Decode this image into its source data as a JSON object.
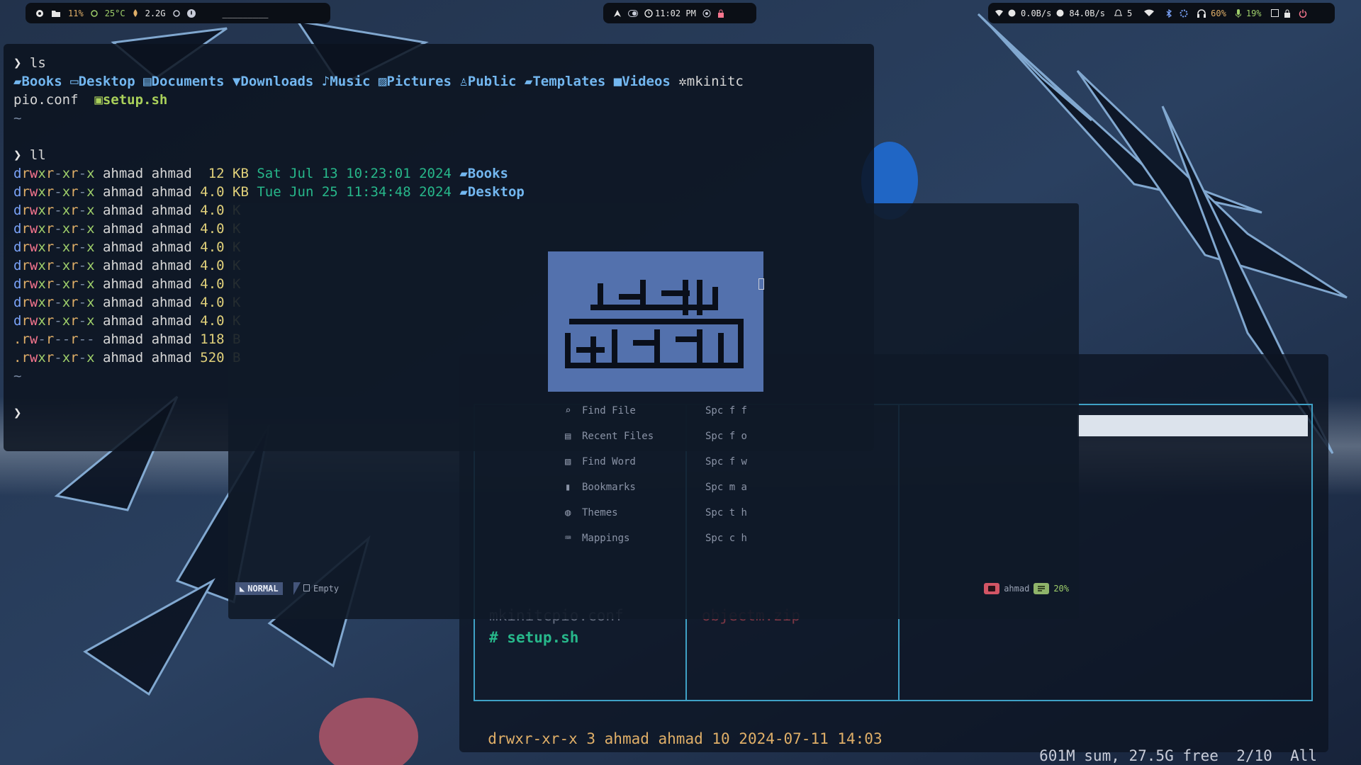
{
  "topbar": {
    "left": {
      "cpu": "11%",
      "temp": "25°C",
      "mem": "2.2G",
      "workspace_line": "_________"
    },
    "center": {
      "clock": "11:02 PM"
    },
    "right": {
      "down": "0.0B/s",
      "up": "84.0B/s",
      "notifications": "5",
      "volume": "60%",
      "mic": "19%"
    }
  },
  "terminal": {
    "prompt": "❯",
    "tilde": "~",
    "cmd1": "ls",
    "ls_items": [
      "Books",
      "Desktop",
      "Documents",
      "Downloads",
      "Music",
      "Pictures",
      "Public",
      "Templates",
      "Videos",
      "mkinitc"
    ],
    "ls_wrap": "pio.conf",
    "ls_exec": "setup.sh",
    "cmd2": "ll",
    "ll_rows": [
      {
        "type": "d",
        "perm": "rwxr-xr-x",
        "user": "ahmad",
        "group": "ahmad",
        "size": " 12 KB",
        "date": "Sat Jul 13 10:23:01 2024",
        "name": "Books"
      },
      {
        "type": "d",
        "perm": "rwxr-xr-x",
        "user": "ahmad",
        "group": "ahmad",
        "size": "4.0 KB",
        "date": "Tue Jun 25 11:34:48 2024",
        "name": "Desktop"
      },
      {
        "type": "d",
        "perm": "rwxr-xr-x",
        "user": "ahmad",
        "group": "ahmad",
        "size": "4.0 K"
      },
      {
        "type": "d",
        "perm": "rwxr-xr-x",
        "user": "ahmad",
        "group": "ahmad",
        "size": "4.0 K"
      },
      {
        "type": "d",
        "perm": "rwxr-xr-x",
        "user": "ahmad",
        "group": "ahmad",
        "size": "4.0 K"
      },
      {
        "type": "d",
        "perm": "rwxr-xr-x",
        "user": "ahmad",
        "group": "ahmad",
        "size": "4.0 K"
      },
      {
        "type": "d",
        "perm": "rwxr-xr-x",
        "user": "ahmad",
        "group": "ahmad",
        "size": "4.0 K"
      },
      {
        "type": "d",
        "perm": "rwxr-xr-x",
        "user": "ahmad",
        "group": "ahmad",
        "size": "4.0 K"
      },
      {
        "type": "d",
        "perm": "rwxr-xr-x",
        "user": "ahmad",
        "group": "ahmad",
        "size": "4.0 K"
      },
      {
        "type": ".",
        "perm": "rw-r--r--",
        "user": "ahmad",
        "group": "ahmad",
        "size": "118 B"
      },
      {
        "type": ".",
        "perm": "rwxr-xr-x",
        "user": "ahmad",
        "group": "ahmad",
        "size": "520 B"
      }
    ]
  },
  "dashboard": {
    "menu": [
      {
        "icon": "search-icon",
        "label": "Find File",
        "keys": "Spc f f"
      },
      {
        "icon": "file-icon",
        "label": "Recent Files",
        "keys": "Spc f o"
      },
      {
        "icon": "text-search-icon",
        "label": "Find Word",
        "keys": "Spc f w"
      },
      {
        "icon": "bookmark-icon",
        "label": "Bookmarks",
        "keys": "Spc m a"
      },
      {
        "icon": "palette-icon",
        "label": "Themes",
        "keys": "Spc t h"
      },
      {
        "icon": "keyboard-icon",
        "label": "Mappings",
        "keys": "Spc c h"
      }
    ],
    "status": {
      "mode": "NORMAL",
      "buffer": "Empty",
      "user": "ahmad",
      "percent": "20%"
    }
  },
  "filemanager": {
    "file1": "mkinitcpio.conf",
    "file2": "setup.sh",
    "file3": "objectm.zip",
    "statusbar": {
      "left": "drwxr-xr-x 3 ahmad ahmad 10 2024-07-11 14:03",
      "right": "601M sum, 27.5G free  2/10  All"
    }
  },
  "colors": {
    "accent": "#3fa1c6",
    "logo_bg": "#5371ad",
    "dir": "#73b7f0",
    "exec": "#a9d05a",
    "date": "#27b78a"
  }
}
